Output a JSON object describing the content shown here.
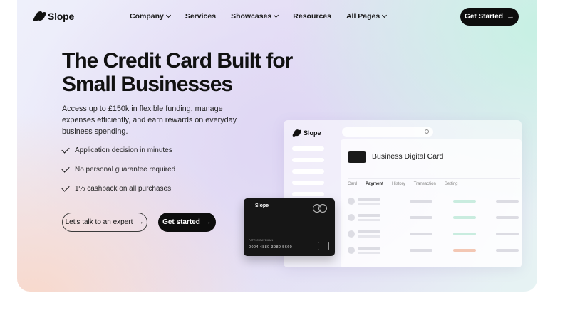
{
  "brand": {
    "name": "Slope"
  },
  "nav": {
    "items": [
      {
        "label": "Company",
        "dropdown": true
      },
      {
        "label": "Services",
        "dropdown": false
      },
      {
        "label": "Showcases",
        "dropdown": true
      },
      {
        "label": "Resources",
        "dropdown": false
      },
      {
        "label": "All Pages",
        "dropdown": true
      }
    ],
    "cta_label": "Get Started"
  },
  "hero": {
    "headline_line1": "The Credit Card Built for",
    "headline_line2": "Small Businesses",
    "subtext": "Access up to £150k in flexible funding, manage expenses efficiently, and earn rewards on everyday business spending.",
    "checklist": [
      "Application decision in minutes",
      "No personal guarantee required",
      "1% cashback on all purchases"
    ],
    "secondary_button": "Let's talk to an expert",
    "primary_button": "Get started"
  },
  "dashboard": {
    "brand": "Slope",
    "title": "Business Digital Card",
    "tabs": [
      "Card",
      "Payment",
      "History",
      "Transaction",
      "Setting"
    ],
    "active_tab": "Payment",
    "status_colors": [
      "#c9ecdf",
      "#c9ecdf",
      "#c9ecdf",
      "#f3c7b4"
    ]
  },
  "card": {
    "brand": "Slope",
    "holder": "PATRIC BATEMAN",
    "number": "0004 4889 3989 5660"
  },
  "colors": {
    "primary": "#0d0d0d"
  }
}
